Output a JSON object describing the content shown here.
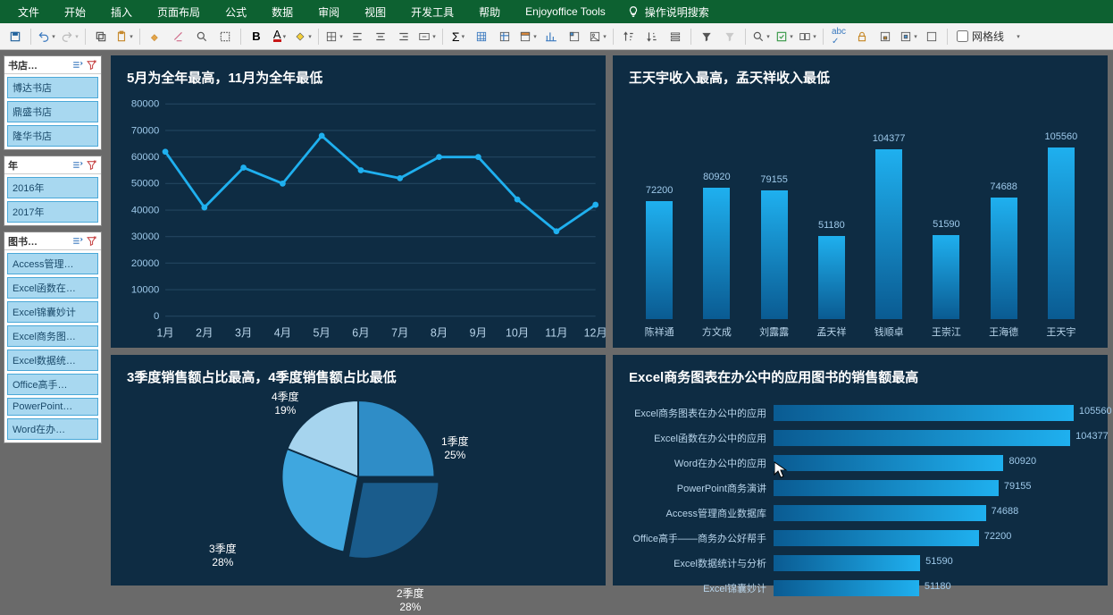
{
  "menu": [
    "文件",
    "开始",
    "插入",
    "页面布局",
    "公式",
    "数据",
    "审阅",
    "视图",
    "开发工具",
    "帮助",
    "Enjoyoffice Tools"
  ],
  "searchHint": "操作说明搜索",
  "gridlinesLabel": "网格线",
  "slicers": [
    {
      "title": "书店…",
      "items": [
        "博达书店",
        "鼎盛书店",
        "隆华书店"
      ]
    },
    {
      "title": "年",
      "items": [
        "2016年",
        "2017年"
      ]
    },
    {
      "title": "图书…",
      "items": [
        "Access管理…",
        "Excel函数在…",
        "Excel锦囊妙计",
        "Excel商务图…",
        "Excel数据统…",
        "Office高手…",
        "PowerPoint…",
        "Word在办…"
      ]
    }
  ],
  "panels": {
    "line": {
      "title": "5月为全年最高，11月为全年最低"
    },
    "vbar": {
      "title": "王天宇收入最高，孟天祥收入最低"
    },
    "pie": {
      "title": "3季度销售额占比最高，4季度销售额占比最低"
    },
    "hbar": {
      "title": "Excel商务图表在办公中的应用图书的销售额最高"
    }
  },
  "chart_data": [
    {
      "type": "line",
      "title": "5月为全年最高，11月为全年最低",
      "categories": [
        "1月",
        "2月",
        "3月",
        "4月",
        "5月",
        "6月",
        "7月",
        "8月",
        "9月",
        "10月",
        "11月",
        "12月"
      ],
      "values": [
        62000,
        41000,
        56000,
        50000,
        68000,
        55000,
        52000,
        60000,
        60000,
        44000,
        32000,
        42000
      ],
      "ylabel": "",
      "xlabel": "",
      "ylim": [
        0,
        80000
      ],
      "yticks": [
        0,
        10000,
        20000,
        30000,
        40000,
        50000,
        60000,
        70000,
        80000
      ]
    },
    {
      "type": "bar",
      "title": "王天宇收入最高，孟天祥收入最低",
      "categories": [
        "陈祥通",
        "方文成",
        "刘露露",
        "孟天祥",
        "钱顺卓",
        "王崇江",
        "王海德",
        "王天宇"
      ],
      "values": [
        72200,
        80920,
        79155,
        51180,
        104377,
        51590,
        74688,
        105560
      ],
      "ylabel": "",
      "xlabel": "",
      "ylim": [
        0,
        110000
      ]
    },
    {
      "type": "pie",
      "title": "3季度销售额占比最高，4季度销售额占比最低",
      "slices": [
        {
          "label": "1季度",
          "pct": 25
        },
        {
          "label": "2季度",
          "pct": 28
        },
        {
          "label": "3季度",
          "pct": 28
        },
        {
          "label": "4季度",
          "pct": 19
        }
      ]
    },
    {
      "type": "bar",
      "orientation": "horizontal",
      "title": "Excel商务图表在办公中的应用图书的销售额最高",
      "categories": [
        "Excel商务图表在办公中的应用",
        "Excel函数在办公中的应用",
        "Word在办公中的应用",
        "PowerPoint商务演讲",
        "Access管理商业数据库",
        "Office高手——商务办公好帮手",
        "Excel数据统计与分析",
        "Excel锦囊妙计"
      ],
      "values": [
        105560,
        104377,
        80920,
        79155,
        74688,
        72200,
        51590,
        51180
      ],
      "xlim": [
        0,
        110000
      ]
    }
  ]
}
